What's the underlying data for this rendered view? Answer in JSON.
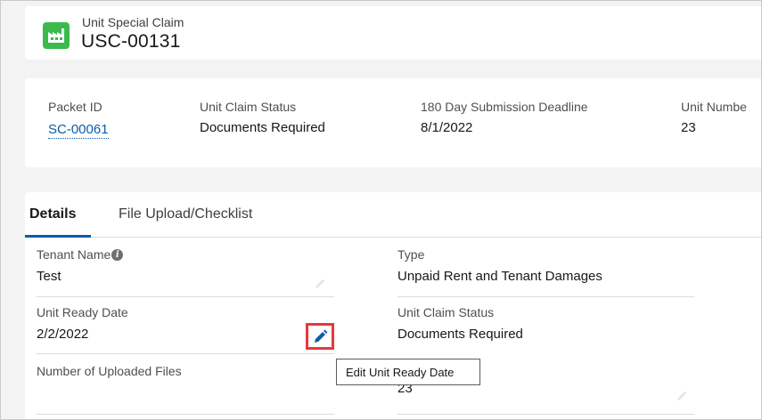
{
  "header": {
    "object_type": "Unit Special Claim",
    "record_name": "USC-00131",
    "icon": "factory-icon",
    "accent_color": "#3bba4c"
  },
  "highlights": {
    "fields": [
      {
        "label": "Packet ID",
        "value": "SC-00061",
        "is_link": true
      },
      {
        "label": "Unit Claim Status",
        "value": "Documents Required",
        "is_link": false
      },
      {
        "label": "180 Day Submission Deadline",
        "value": "8/1/2022",
        "is_link": false
      },
      {
        "label": "Unit Numbe",
        "value": "23",
        "is_link": false
      }
    ]
  },
  "tabs": [
    {
      "label": "Details",
      "active": true
    },
    {
      "label": "File Upload/Checklist",
      "active": false
    }
  ],
  "details": {
    "tenant_name": {
      "label": "Tenant Name",
      "value": "Test",
      "info_icon": "info-icon"
    },
    "type": {
      "label": "Type",
      "value": "Unpaid Rent and Tenant Damages"
    },
    "unit_ready_date": {
      "label": "Unit Ready Date",
      "value": "2/2/2022",
      "edit_icon": "pencil-icon"
    },
    "unit_claim_status": {
      "label": "Unit Claim Status",
      "value": "Documents Required"
    },
    "number_of_uploaded_files": {
      "label": "Number of Uploaded Files",
      "value": ""
    },
    "unit_number": {
      "value": "23"
    }
  },
  "tooltip": {
    "text": "Edit Unit Ready Date"
  },
  "colors": {
    "link": "#0b5cab",
    "highlight_box": "#e8383b",
    "tab_underline": "#0b5cab"
  }
}
